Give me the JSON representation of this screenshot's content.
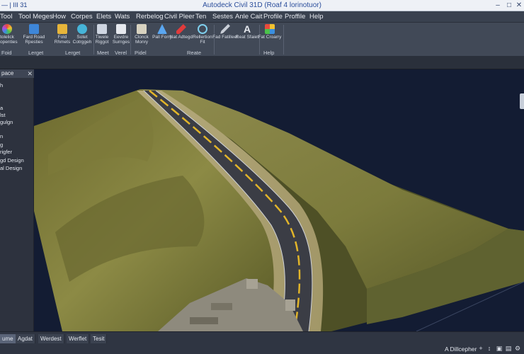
{
  "window": {
    "left_text": "— | III 31",
    "title": "Autodeck Civil 31D (Roaf 4 lorinotuor)",
    "minimize": "–",
    "maximize": "□",
    "close": "✕"
  },
  "menu": [
    "Tool",
    "Tool Meges",
    "How",
    "Corpes",
    "Elets",
    "Wats",
    "Rerbelog",
    "Civil Pleer",
    "Ten",
    "Sestes",
    "Anle Cait",
    "Profile",
    "Proffile",
    "Help"
  ],
  "ribbon": {
    "tools": [
      {
        "label": "tolelick Ropenties",
        "icon": "color-wheel-icon"
      },
      {
        "label": "Fard Road Rpesties",
        "icon": "road-icon"
      },
      {
        "label": "Fold Rhmets",
        "icon": "folder-icon"
      },
      {
        "label": "Sotet Cotrggeh",
        "icon": "globe-icon"
      },
      {
        "label": "Tiwele Riggot",
        "icon": "table-icon"
      },
      {
        "label": "Eevdre Surnges",
        "icon": "document-icon"
      },
      {
        "label": "Clonck Monry",
        "icon": "pencil-icon"
      },
      {
        "label": "Pall Forry",
        "icon": "triangle-icon"
      },
      {
        "label": "Nat Adtegd",
        "icon": "marker-icon"
      },
      {
        "label": "Rellertion Fit",
        "icon": "search-icon"
      },
      {
        "label": "Fad Fatilleet",
        "icon": "brush-icon"
      },
      {
        "label": "Reat Sfaiet",
        "icon": "text-icon"
      },
      {
        "label": "Fat Croarry",
        "icon": "puzzle-icon"
      }
    ],
    "groups": [
      "Foid",
      "Lerget",
      "Lerget",
      "Meet",
      "Verel",
      "Pidel",
      "Reate",
      "Help"
    ]
  },
  "panel": {
    "header": "pace",
    "close": "✕",
    "items": [
      "h",
      "a",
      "lst",
      "gulgn",
      "n",
      "g",
      "rigfer",
      "gd Design",
      "al Design"
    ]
  },
  "bottom": {
    "tabs": [
      "ume",
      "Agdat",
      "Werdest",
      "Werflet",
      "Tesit"
    ],
    "status": "A Dillcepher",
    "status_icons": [
      "+",
      "↕",
      "▣",
      "▤",
      "⚙"
    ]
  }
}
